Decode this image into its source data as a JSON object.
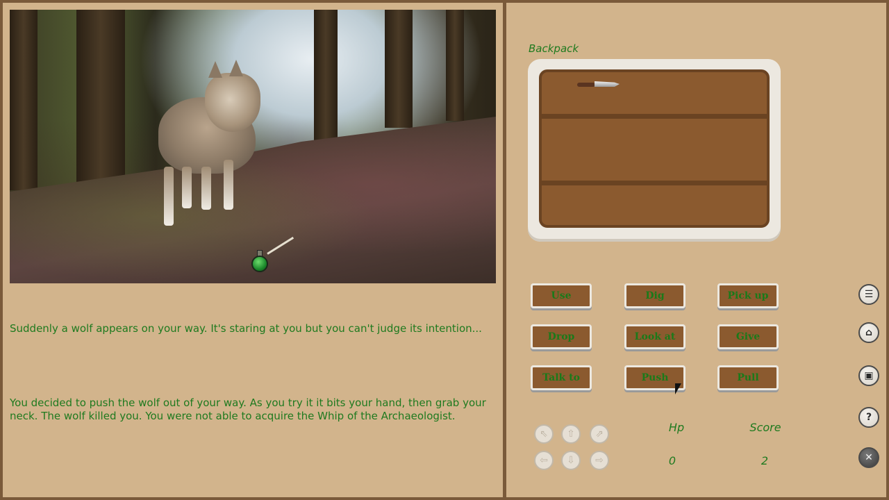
{
  "narration": {
    "line1": "Suddenly a wolf appears on your way. It's staring at you but you can't judge its intention...",
    "line2": "You decided to push the wolf out of your way. As you try it it bits your hand, then grab your neck. The wolf killed you. You were not able to acquire the Whip of the Archaeologist."
  },
  "backpack": {
    "label": "Backpack",
    "items": [
      "knife-icon"
    ]
  },
  "verbs": [
    "Use",
    "Dig",
    "Pick up",
    "Drop",
    "Look at",
    "Give",
    "Talk to",
    "Push",
    "Pull"
  ],
  "directions": {
    "up_left": "⇖",
    "up": "⇧",
    "up_right": "⇗",
    "left": "⇦",
    "down": "⇩",
    "right": "⇨"
  },
  "stats": {
    "hp_label": "Hp",
    "hp_value": "0",
    "score_label": "Score",
    "score_value": "2"
  },
  "side_icons": {
    "list": "☰",
    "home": "⌂",
    "save": "▣",
    "help": "?",
    "close": "✕"
  },
  "colors": {
    "background": "#d2b48c",
    "text_green": "#1f7a1f",
    "wood": "#8b5a2f",
    "frame": "#7a5a3a"
  }
}
